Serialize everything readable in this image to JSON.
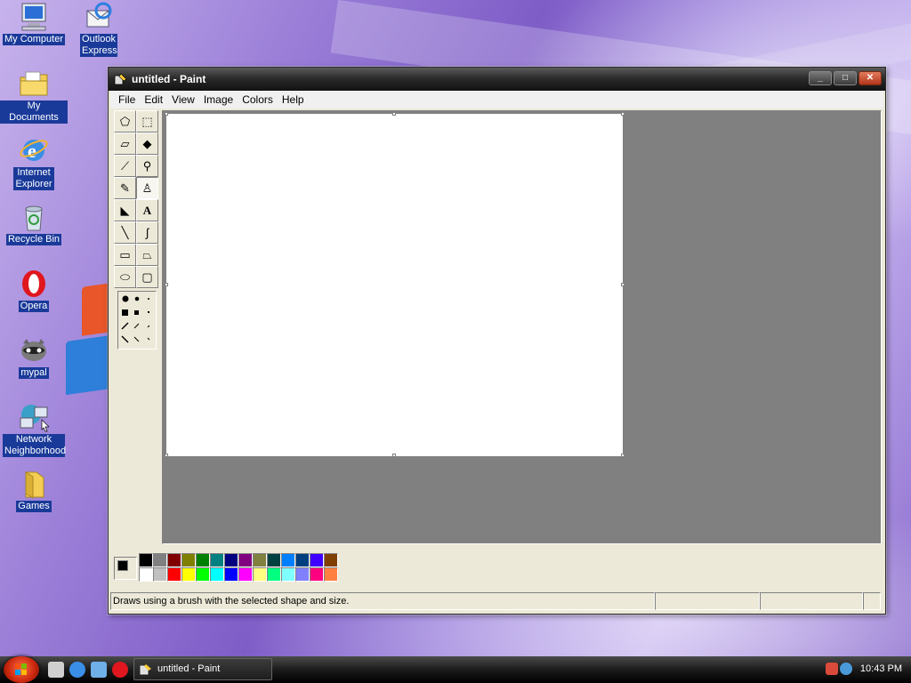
{
  "desktop": {
    "icons": [
      {
        "label": "My Computer"
      },
      {
        "label": "Outlook Express"
      },
      {
        "label": "My Documents"
      },
      {
        "label": "Internet Explorer"
      },
      {
        "label": "Recycle Bin"
      },
      {
        "label": "Opera"
      },
      {
        "label": "mypal"
      },
      {
        "label": "Network Neighborhood"
      },
      {
        "label": "Games"
      }
    ]
  },
  "window": {
    "title": "untitled - Paint",
    "controls": {
      "minimize": "_",
      "maximize": "□",
      "close": "✕"
    }
  },
  "menu": {
    "items": [
      "File",
      "Edit",
      "View",
      "Image",
      "Colors",
      "Help"
    ]
  },
  "tools": [
    {
      "name": "free-select-tool",
      "glyph": "⬠"
    },
    {
      "name": "rect-select-tool",
      "glyph": "⬚"
    },
    {
      "name": "eraser-tool",
      "glyph": "▱"
    },
    {
      "name": "fill-tool",
      "glyph": "◆"
    },
    {
      "name": "color-picker-tool",
      "glyph": "⟋"
    },
    {
      "name": "magnifier-tool",
      "glyph": "⚲"
    },
    {
      "name": "pencil-tool",
      "glyph": "✎"
    },
    {
      "name": "brush-tool",
      "glyph": "♙"
    },
    {
      "name": "airbrush-tool",
      "glyph": "◣"
    },
    {
      "name": "text-tool",
      "glyph": "A"
    },
    {
      "name": "line-tool",
      "glyph": "╲"
    },
    {
      "name": "curve-tool",
      "glyph": "∫"
    },
    {
      "name": "rectangle-tool",
      "glyph": "▭"
    },
    {
      "name": "polygon-tool",
      "glyph": "⏢"
    },
    {
      "name": "ellipse-tool",
      "glyph": "⬭"
    },
    {
      "name": "rounded-rect-tool",
      "glyph": "▢"
    }
  ],
  "active_tool": "brush-tool",
  "palette": {
    "foreground": "#000000",
    "background": "#ffffff",
    "row1": [
      "#000000",
      "#808080",
      "#800000",
      "#808000",
      "#008000",
      "#008080",
      "#000080",
      "#800080",
      "#808040",
      "#004040",
      "#0080ff",
      "#004080",
      "#4000ff",
      "#804000"
    ],
    "row2": [
      "#ffffff",
      "#c0c0c0",
      "#ff0000",
      "#ffff00",
      "#00ff00",
      "#00ffff",
      "#0000ff",
      "#ff00ff",
      "#ffff80",
      "#00ff80",
      "#80ffff",
      "#8080ff",
      "#ff0080",
      "#ff8040"
    ]
  },
  "status": {
    "message": "Draws using a brush with the selected shape and size."
  },
  "taskbar": {
    "task_label": "untitled - Paint",
    "clock": "10:43 PM"
  }
}
